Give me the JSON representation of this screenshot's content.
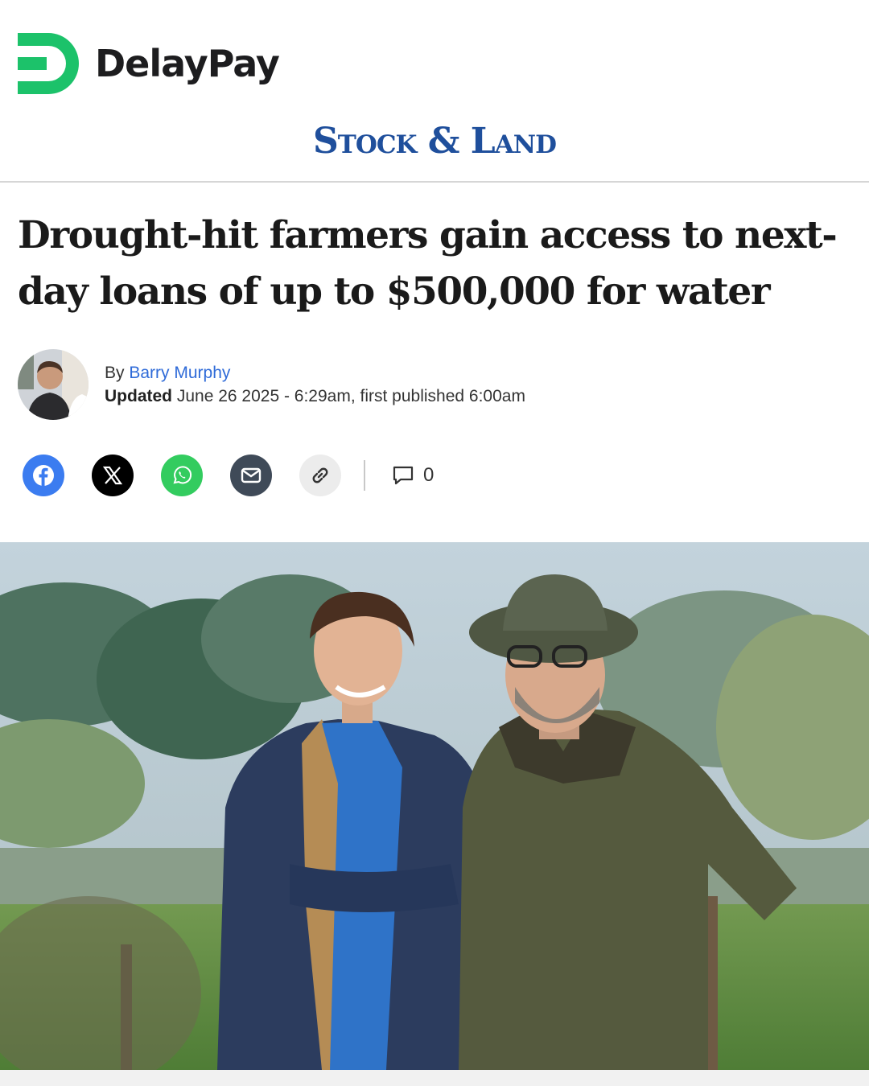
{
  "brand": {
    "name": "DelayPay",
    "color": "#1cc26a",
    "icon": "delaypay-d-logo"
  },
  "masthead": {
    "title": "Stock & Land",
    "color": "#1f4f9c"
  },
  "article": {
    "headline": "Drought-hit farmers gain access to next-day loans of up to $500,000 for water",
    "byline_prefix": "By",
    "author": "Barry Murphy",
    "updated_label": "Updated",
    "updated_text": "June 26 2025 - 6:29am, first published 6:00am"
  },
  "share": {
    "buttons": [
      {
        "icon": "facebook-icon",
        "color": "#3b7cf0"
      },
      {
        "icon": "x-icon",
        "color": "#000000"
      },
      {
        "icon": "whatsapp-icon",
        "color": "#33cc5f"
      },
      {
        "icon": "email-icon",
        "color": "#3f4a58"
      },
      {
        "icon": "link-icon",
        "color": "#ececec"
      }
    ],
    "comment_icon": "comment-icon",
    "comment_count": "0"
  },
  "hero": {
    "description_icon": "photo-two-men-farm"
  }
}
